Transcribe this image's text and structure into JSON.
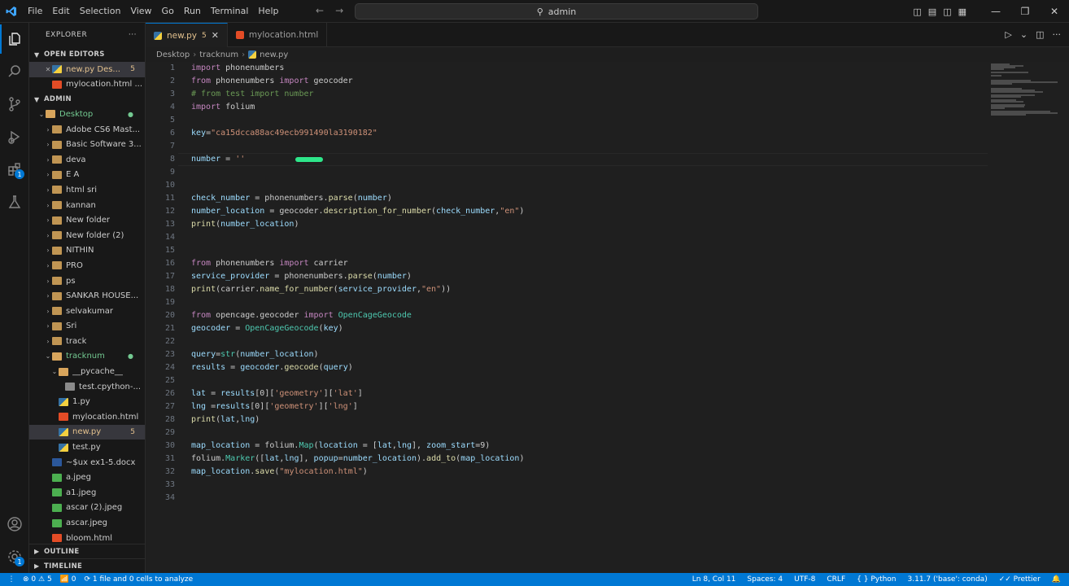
{
  "menu": [
    "File",
    "Edit",
    "Selection",
    "View",
    "Go",
    "Run",
    "Terminal",
    "Help"
  ],
  "command_center": "admin",
  "sidebar": {
    "title": "EXPLORER",
    "open_editors_label": "OPEN EDITORS",
    "open_editors": [
      {
        "name": "new.py",
        "desc": "Des...",
        "mod": "5"
      },
      {
        "name": "mylocation.html",
        "desc": "..."
      }
    ],
    "folder_label": "ADMIN",
    "tree": [
      {
        "name": "Desktop",
        "type": "folder-open",
        "depth": 1,
        "dot": "●"
      },
      {
        "name": "Adobe CS6 Mast...",
        "type": "folder",
        "depth": 2
      },
      {
        "name": "Basic Software 3...",
        "type": "folder",
        "depth": 2
      },
      {
        "name": "deva",
        "type": "folder",
        "depth": 2
      },
      {
        "name": "E A",
        "type": "folder",
        "depth": 2
      },
      {
        "name": "html sri",
        "type": "folder",
        "depth": 2
      },
      {
        "name": "kannan",
        "type": "folder",
        "depth": 2
      },
      {
        "name": "New folder",
        "type": "folder",
        "depth": 2
      },
      {
        "name": "New folder (2)",
        "type": "folder",
        "depth": 2
      },
      {
        "name": "NITHIN",
        "type": "folder",
        "depth": 2
      },
      {
        "name": "PRO",
        "type": "folder",
        "depth": 2
      },
      {
        "name": "ps",
        "type": "folder",
        "depth": 2
      },
      {
        "name": "SANKAR HOUSE...",
        "type": "folder",
        "depth": 2
      },
      {
        "name": "selvakumar",
        "type": "folder",
        "depth": 2
      },
      {
        "name": "Sri",
        "type": "folder",
        "depth": 2
      },
      {
        "name": "track",
        "type": "folder",
        "depth": 2
      },
      {
        "name": "tracknum",
        "type": "folder-open",
        "depth": 2,
        "dot": "●"
      },
      {
        "name": "__pycache__",
        "type": "folder-open",
        "depth": 3
      },
      {
        "name": "test.cpython-...",
        "type": "file",
        "depth": 4
      },
      {
        "name": "1.py",
        "type": "py",
        "depth": 3
      },
      {
        "name": "mylocation.html",
        "type": "html",
        "depth": 3
      },
      {
        "name": "new.py",
        "type": "py",
        "depth": 3,
        "mod": "5",
        "selected": true
      },
      {
        "name": "test.py",
        "type": "py",
        "depth": 3
      },
      {
        "name": "~$ux ex1-5.docx",
        "type": "doc",
        "depth": 2
      },
      {
        "name": "a.jpeg",
        "type": "img",
        "depth": 2
      },
      {
        "name": "a1.jpeg",
        "type": "img",
        "depth": 2
      },
      {
        "name": "ascar (2).jpeg",
        "type": "img",
        "depth": 2
      },
      {
        "name": "ascar.jpeg",
        "type": "img",
        "depth": 2
      },
      {
        "name": "bloom.html",
        "type": "html",
        "depth": 2
      }
    ],
    "outline_label": "OUTLINE",
    "timeline_label": "TIMELINE"
  },
  "tabs": [
    {
      "name": "new.py",
      "mod": "5",
      "active": true
    },
    {
      "name": "mylocation.html",
      "active": false
    }
  ],
  "breadcrumb": [
    "Desktop",
    "tracknum",
    "new.py"
  ],
  "code": [
    {
      "n": "1",
      "html": "<span class='tok-kw'>import</span> phonenumbers"
    },
    {
      "n": "2",
      "html": "<span class='tok-kw'>from</span> phonenumbers <span class='tok-kw'>import</span> geocoder"
    },
    {
      "n": "3",
      "html": "<span class='tok-cm'># from test import number</span>"
    },
    {
      "n": "4",
      "html": "<span class='tok-kw'>import</span> folium"
    },
    {
      "n": "5",
      "html": ""
    },
    {
      "n": "6",
      "html": "<span class='tok-var'>key</span>=<span class='tok-str'>\"ca15dcca88ac49ecb991490la3190182\"</span>"
    },
    {
      "n": "7",
      "html": ""
    },
    {
      "n": "8",
      "html": "<span class='tok-var'>number</span> = <span class='tok-str'>''</span>"
    },
    {
      "n": "9",
      "html": ""
    },
    {
      "n": "10",
      "html": ""
    },
    {
      "n": "11",
      "html": "<span class='tok-var'>check_number</span> = phonenumbers.<span class='tok-fn'>parse</span>(<span class='tok-var'>number</span>)"
    },
    {
      "n": "12",
      "html": "<span class='tok-var'>number_location</span> = geocoder.<span class='tok-fn'>description_for_number</span>(<span class='tok-var'>check_number</span>,<span class='tok-str'>\"en\"</span>)"
    },
    {
      "n": "13",
      "html": "<span class='tok-fn'>print</span>(<span class='tok-var'>number_location</span>)"
    },
    {
      "n": "14",
      "html": ""
    },
    {
      "n": "15",
      "html": ""
    },
    {
      "n": "16",
      "html": "<span class='tok-kw'>from</span> phonenumbers <span class='tok-kw'>import</span> carrier"
    },
    {
      "n": "17",
      "html": "<span class='tok-var'>service_provider</span> = phonenumbers.<span class='tok-fn'>parse</span>(<span class='tok-var'>number</span>)"
    },
    {
      "n": "18",
      "html": "<span class='tok-fn'>print</span>(carrier.<span class='tok-fn'>name_for_number</span>(<span class='tok-var'>service_provider</span>,<span class='tok-str'>\"en\"</span>))"
    },
    {
      "n": "19",
      "html": ""
    },
    {
      "n": "20",
      "html": "<span class='tok-kw'>from</span> opencage.geocoder <span class='tok-kw'>import</span> <span class='tok-cls'>OpenCageGeocode</span>"
    },
    {
      "n": "21",
      "html": "<span class='tok-var'>geocoder</span> = <span class='tok-cls'>OpenCageGeocode</span>(<span class='tok-var'>key</span>)"
    },
    {
      "n": "22",
      "html": ""
    },
    {
      "n": "23",
      "html": "<span class='tok-var'>query</span>=<span class='tok-cls'>str</span>(<span class='tok-var'>number_location</span>)"
    },
    {
      "n": "24",
      "html": "<span class='tok-var'>results</span> = <span class='tok-var'>geocoder</span>.<span class='tok-fn'>geocode</span>(<span class='tok-var'>query</span>)"
    },
    {
      "n": "25",
      "html": ""
    },
    {
      "n": "26",
      "html": "<span class='tok-var'>lat</span> = <span class='tok-var'>results</span>[0][<span class='tok-str'>'geometry'</span>][<span class='tok-str'>'lat'</span>]"
    },
    {
      "n": "27",
      "html": "<span class='tok-var'>lng</span> =<span class='tok-var'>results</span>[0][<span class='tok-str'>'geometry'</span>][<span class='tok-str'>'lng'</span>]"
    },
    {
      "n": "28",
      "html": "<span class='tok-fn'>print</span>(<span class='tok-var'>lat</span>,<span class='tok-var'>lng</span>)"
    },
    {
      "n": "29",
      "html": ""
    },
    {
      "n": "30",
      "html": "<span class='tok-var'>map_location</span> = folium.<span class='tok-cls'>Map</span>(<span class='tok-var'>location</span> = [<span class='tok-var'>lat</span>,<span class='tok-var'>lng</span>], <span class='tok-var'>zoom_start</span>=9)"
    },
    {
      "n": "31",
      "html": "folium.<span class='tok-cls'>Marker</span>([<span class='tok-var'>lat</span>,<span class='tok-var'>lng</span>], <span class='tok-var'>popup</span>=<span class='tok-var'>number_location</span>).<span class='tok-fn'>add_to</span>(<span class='tok-var'>map_location</span>)"
    },
    {
      "n": "32",
      "html": "<span class='tok-var'>map_location</span>.<span class='tok-fn'>save</span>(<span class='tok-str'>\"mylocation.html\"</span>)"
    },
    {
      "n": "33",
      "html": ""
    },
    {
      "n": "34",
      "html": ""
    }
  ],
  "status": {
    "errors": "0",
    "warnings": "5",
    "ports": "0",
    "analyzing": "1 file and 0 cells to analyze",
    "position": "Ln 8, Col 11",
    "spaces": "Spaces: 4",
    "encoding": "UTF-8",
    "eol": "CRLF",
    "language": "Python",
    "interpreter": "3.11.7 ('base': conda)",
    "prettier": "Prettier"
  },
  "colors": {
    "accent": "#0078d4",
    "modified": "#e2c08d",
    "untracked": "#73c991"
  }
}
